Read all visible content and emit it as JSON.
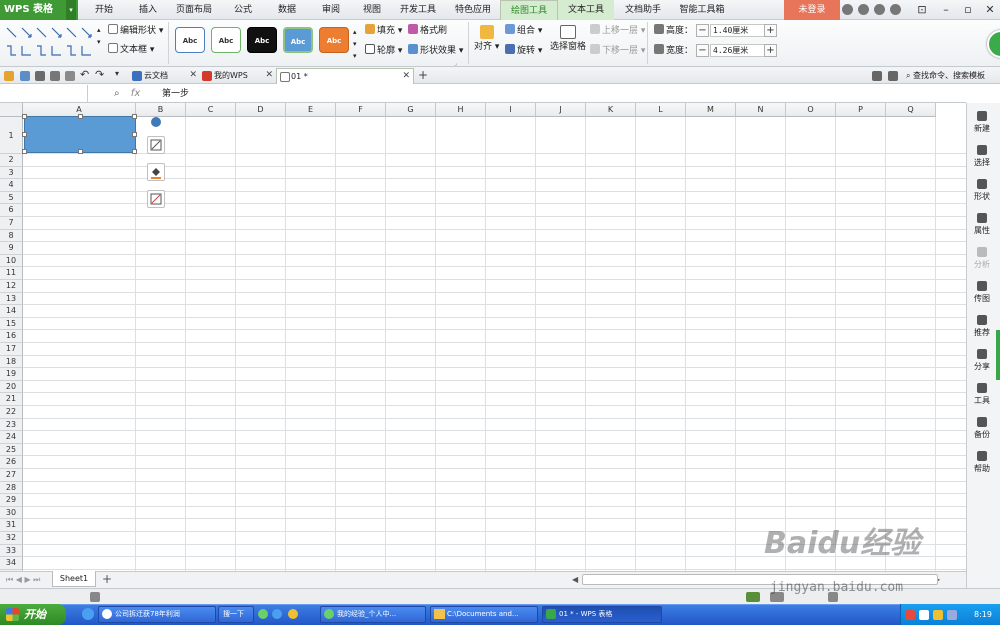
{
  "app": {
    "logo": "WPS 表格",
    "login": "未登录"
  },
  "menu_tabs": [
    "开始",
    "插入",
    "页面布局",
    "公式",
    "数据",
    "审阅",
    "视图",
    "开发工具",
    "特色应用",
    "绘图工具",
    "文本工具",
    "文档助手",
    "智能工具箱"
  ],
  "active_tab": "绘图工具",
  "ribbon": {
    "edit_shape": "编辑形状",
    "textbox": "文本框",
    "style_sample": "Abc",
    "fill": "填充",
    "format_brush": "格式刷",
    "outline": "轮廓",
    "shape_effect": "形状效果",
    "align": "对齐",
    "group": "组合",
    "rotate": "旋转",
    "selection_pane": "选择窗格",
    "bring_forward": "上移一层",
    "send_backward": "下移一层",
    "height_label": "高度：",
    "height_value": "1.40厘米",
    "width_label": "宽度：",
    "width_value": "4.26厘米",
    "plus": "+",
    "minus": "−"
  },
  "doc_tabs": [
    {
      "label": "云文档"
    },
    {
      "label": "我的WPS"
    },
    {
      "label": "01 *"
    }
  ],
  "command_search": "查找命令、搜索模板",
  "formula_bar": {
    "fx": "fx",
    "content": "第一步"
  },
  "columns": [
    "A",
    "B",
    "C",
    "D",
    "E",
    "F",
    "G",
    "H",
    "I",
    "J",
    "K",
    "L",
    "M",
    "N",
    "O",
    "P",
    "Q"
  ],
  "rows": [
    "1",
    "2",
    "3",
    "4",
    "5",
    "6",
    "7",
    "8",
    "9",
    "10",
    "11",
    "12",
    "13",
    "14",
    "15",
    "16",
    "17",
    "18",
    "19",
    "20",
    "21",
    "22",
    "23",
    "24",
    "25",
    "26",
    "27",
    "28",
    "29",
    "30",
    "31",
    "32",
    "33",
    "34",
    "35"
  ],
  "sidebar": [
    {
      "label": "新建",
      "enabled": true
    },
    {
      "label": "选择",
      "enabled": true
    },
    {
      "label": "形状",
      "enabled": true
    },
    {
      "label": "属性",
      "enabled": true
    },
    {
      "label": "分析",
      "enabled": false
    },
    {
      "label": "传图",
      "enabled": true
    },
    {
      "label": "推荐",
      "enabled": true
    },
    {
      "label": "分享",
      "enabled": true
    },
    {
      "label": "工具",
      "enabled": true
    },
    {
      "label": "备份",
      "enabled": true
    },
    {
      "label": "帮助",
      "enabled": true
    }
  ],
  "sheet_tab": "Sheet1",
  "add_sheet": "+",
  "taskbar": {
    "start": "开始",
    "items": [
      "公司拆迁获78年利润",
      "搜一下",
      "我的经验_个人中...",
      "C:\\Documents and...",
      "01 * - WPS 表格"
    ],
    "active_item": "01 * - WPS 表格",
    "clock": "8:19"
  },
  "watermark": {
    "brand": "Baidu经验",
    "url": "jingyan.baidu.com"
  },
  "colors": {
    "accent": "#3f9a35",
    "shape_fill": "#5b9bd5",
    "login": "#e8745a",
    "taskbar": "#2356c8"
  }
}
